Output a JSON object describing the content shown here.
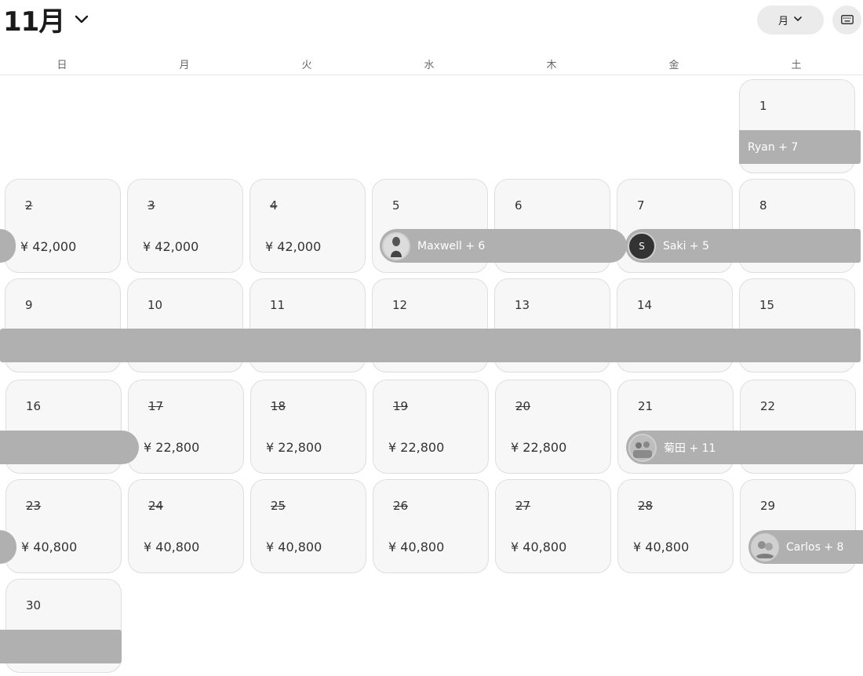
{
  "header": {
    "month_title": "11月",
    "view_selector_label": "月"
  },
  "weekdays": [
    "日",
    "月",
    "火",
    "水",
    "木",
    "金",
    "土"
  ],
  "days": [
    {
      "day": "1",
      "price": "",
      "past": false
    },
    {
      "day": "2",
      "price": "¥ 42,000",
      "past": true
    },
    {
      "day": "3",
      "price": "¥ 42,000",
      "past": true
    },
    {
      "day": "4",
      "price": "¥ 42,000",
      "past": true
    },
    {
      "day": "5",
      "price": "",
      "past": false
    },
    {
      "day": "6",
      "price": "",
      "past": false
    },
    {
      "day": "7",
      "price": "",
      "past": false
    },
    {
      "day": "8",
      "price": "",
      "past": false
    },
    {
      "day": "9",
      "price": "",
      "past": false
    },
    {
      "day": "10",
      "price": "",
      "past": false
    },
    {
      "day": "11",
      "price": "",
      "past": false
    },
    {
      "day": "12",
      "price": "",
      "past": false
    },
    {
      "day": "13",
      "price": "",
      "past": false
    },
    {
      "day": "14",
      "price": "",
      "past": false
    },
    {
      "day": "15",
      "price": "",
      "past": false
    },
    {
      "day": "16",
      "price": "",
      "past": false
    },
    {
      "day": "17",
      "price": "¥ 22,800",
      "past": true
    },
    {
      "day": "18",
      "price": "¥ 22,800",
      "past": true
    },
    {
      "day": "19",
      "price": "¥ 22,800",
      "past": true
    },
    {
      "day": "20",
      "price": "¥ 22,800",
      "past": true
    },
    {
      "day": "21",
      "price": "",
      "past": false
    },
    {
      "day": "22",
      "price": "",
      "past": false
    },
    {
      "day": "23",
      "price": "¥ 40,800",
      "past": true
    },
    {
      "day": "24",
      "price": "¥ 40,800",
      "past": true
    },
    {
      "day": "25",
      "price": "¥ 40,800",
      "past": true
    },
    {
      "day": "26",
      "price": "¥ 40,800",
      "past": true
    },
    {
      "day": "27",
      "price": "¥ 40,800",
      "past": true
    },
    {
      "day": "28",
      "price": "¥ 40,800",
      "past": true
    },
    {
      "day": "29",
      "price": "",
      "past": false
    },
    {
      "day": "30",
      "price": "",
      "past": false
    }
  ],
  "reservations": {
    "ryan": {
      "label": "Ryan + 7"
    },
    "maxwell": {
      "label": "Maxwell + 6"
    },
    "saki": {
      "label": "Saki + 5",
      "avatar_initial": "S"
    },
    "kikuta": {
      "label": "菊田 + 11"
    },
    "carlos": {
      "label": "Carlos + 8"
    }
  },
  "colors": {
    "reservation_bar": "#b0b0b0",
    "cell_background": "#f7f7f7",
    "cell_border": "#dedede"
  }
}
